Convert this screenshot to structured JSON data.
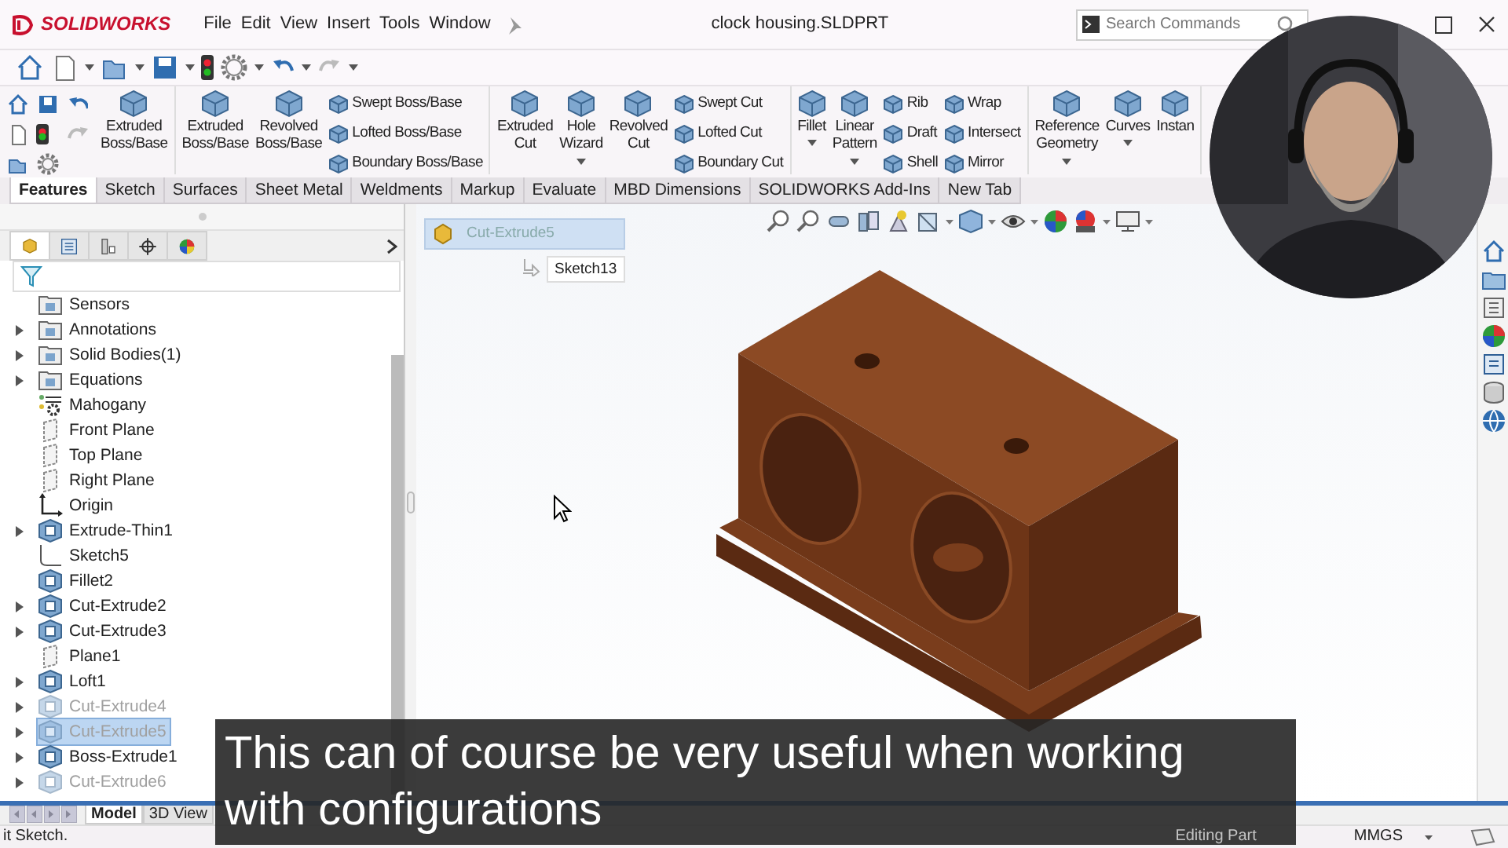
{
  "app": {
    "brand": "SOLIDWORKS",
    "menu": [
      "File",
      "Edit",
      "View",
      "Insert",
      "Tools",
      "Window"
    ],
    "document_title": "clock housing.SLDPRT",
    "search": {
      "placeholder": "Search Commands"
    }
  },
  "ribbon": {
    "groups": [
      {
        "items": [
          {
            "kind": "large",
            "label": "Extruded Boss/Base",
            "dropdown": false
          }
        ]
      },
      {
        "items": [
          {
            "kind": "large",
            "label": "Extruded Boss/Base",
            "dropdown": false
          },
          {
            "kind": "large",
            "label": "Revolved Boss/Base",
            "dropdown": false
          },
          {
            "kind": "column",
            "items": [
              "Swept Boss/Base",
              "Lofted Boss/Base",
              "Boundary Boss/Base"
            ]
          }
        ]
      },
      {
        "items": [
          {
            "kind": "large",
            "label": "Extruded Cut",
            "dropdown": false
          },
          {
            "kind": "large",
            "label": "Hole Wizard",
            "dropdown": true
          },
          {
            "kind": "large",
            "label": "Revolved Cut",
            "dropdown": false
          },
          {
            "kind": "column",
            "items": [
              "Swept Cut",
              "Lofted Cut",
              "Boundary Cut"
            ]
          }
        ]
      },
      {
        "items": [
          {
            "kind": "large",
            "label": "Fillet",
            "dropdown": true
          },
          {
            "kind": "large",
            "label": "Linear Pattern",
            "dropdown": true
          },
          {
            "kind": "column",
            "items": [
              "Rib",
              "Draft",
              "Shell"
            ]
          },
          {
            "kind": "column",
            "items": [
              "Wrap",
              "Intersect",
              "Mirror"
            ]
          }
        ]
      },
      {
        "items": [
          {
            "kind": "large",
            "label": "Reference Geometry",
            "dropdown": true
          },
          {
            "kind": "large",
            "label": "Curves",
            "dropdown": true
          },
          {
            "kind": "large",
            "label": "Instan",
            "dropdown": false
          }
        ]
      }
    ]
  },
  "tabs": [
    {
      "label": "Features",
      "selected": true
    },
    {
      "label": "Sketch",
      "selected": false
    },
    {
      "label": "Surfaces",
      "selected": false
    },
    {
      "label": "Sheet Metal",
      "selected": false
    },
    {
      "label": "Weldments",
      "selected": false
    },
    {
      "label": "Markup",
      "selected": false
    },
    {
      "label": "Evaluate",
      "selected": false
    },
    {
      "label": "MBD Dimensions",
      "selected": false
    },
    {
      "label": "SOLIDWORKS Add-Ins",
      "selected": false
    },
    {
      "label": "New Tab",
      "selected": false
    }
  ],
  "manager_tabs": [
    {
      "selected": true
    },
    {
      "selected": false
    },
    {
      "selected": false
    },
    {
      "selected": false
    },
    {
      "selected": false
    }
  ],
  "feature_tree": [
    {
      "kind": "folder",
      "label": "Sensors",
      "expandable": false,
      "suppressed": false,
      "selected": false
    },
    {
      "kind": "folder",
      "label": "Annotations",
      "expandable": true,
      "suppressed": false,
      "selected": false
    },
    {
      "kind": "folder",
      "label": "Solid Bodies(1)",
      "expandable": true,
      "suppressed": false,
      "selected": false
    },
    {
      "kind": "folder",
      "label": "Equations",
      "expandable": true,
      "suppressed": false,
      "selected": false
    },
    {
      "kind": "material",
      "label": "Mahogany",
      "expandable": false,
      "suppressed": false,
      "selected": false
    },
    {
      "kind": "plane",
      "label": "Front Plane",
      "expandable": false,
      "suppressed": false,
      "selected": false
    },
    {
      "kind": "plane",
      "label": "Top Plane",
      "expandable": false,
      "suppressed": false,
      "selected": false
    },
    {
      "kind": "plane",
      "label": "Right Plane",
      "expandable": false,
      "suppressed": false,
      "selected": false
    },
    {
      "kind": "origin",
      "label": "Origin",
      "expandable": false,
      "suppressed": false,
      "selected": false
    },
    {
      "kind": "feature",
      "label": "Extrude-Thin1",
      "expandable": true,
      "suppressed": false,
      "selected": false
    },
    {
      "kind": "sketch",
      "label": "Sketch5",
      "expandable": false,
      "suppressed": false,
      "selected": false
    },
    {
      "kind": "feature",
      "label": "Fillet2",
      "expandable": false,
      "suppressed": false,
      "selected": false
    },
    {
      "kind": "feature",
      "label": "Cut-Extrude2",
      "expandable": true,
      "suppressed": false,
      "selected": false
    },
    {
      "kind": "feature",
      "label": "Cut-Extrude3",
      "expandable": true,
      "suppressed": false,
      "selected": false
    },
    {
      "kind": "plane",
      "label": "Plane1",
      "expandable": false,
      "suppressed": false,
      "selected": false
    },
    {
      "kind": "feature",
      "label": "Loft1",
      "expandable": true,
      "suppressed": false,
      "selected": false
    },
    {
      "kind": "feature",
      "label": "Cut-Extrude4",
      "expandable": true,
      "suppressed": true,
      "selected": false
    },
    {
      "kind": "feature",
      "label": "Cut-Extrude5",
      "expandable": true,
      "suppressed": true,
      "selected": true
    },
    {
      "kind": "feature",
      "label": "Boss-Extrude1",
      "expandable": true,
      "suppressed": false,
      "selected": false
    },
    {
      "kind": "feature",
      "label": "Cut-Extrude6",
      "expandable": true,
      "suppressed": true,
      "selected": false
    }
  ],
  "breadcrumb": {
    "feature": "Cut-Extrude5",
    "sketch": "Sketch13"
  },
  "bottom_tabs": [
    {
      "label": "Model",
      "selected": true
    },
    {
      "label": "3D View",
      "selected": false
    }
  ],
  "status_bar": {
    "message": "it Sketch.",
    "mode": "Editing Part",
    "units": "MMGS"
  },
  "subtitle": "This can of course be very useful when working\nwith configurations"
}
